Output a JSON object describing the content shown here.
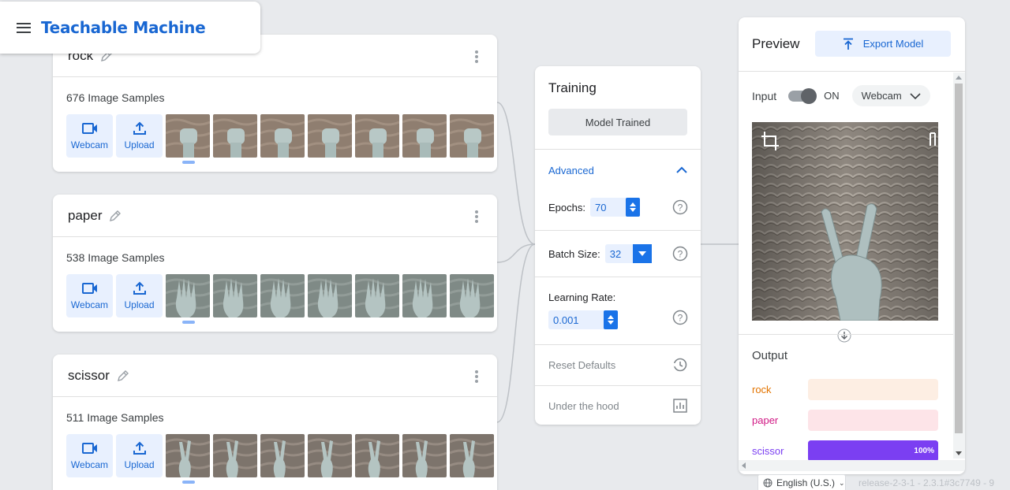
{
  "header": {
    "app_title": "Teachable Machine"
  },
  "classes": [
    {
      "name": "rock",
      "samples": "676 Image Samples",
      "webcam_label": "Webcam",
      "upload_label": "Upload",
      "thumb_count": 7
    },
    {
      "name": "paper",
      "samples": "538 Image Samples",
      "webcam_label": "Webcam",
      "upload_label": "Upload",
      "thumb_count": 7
    },
    {
      "name": "scissor",
      "samples": "511 Image Samples",
      "webcam_label": "Webcam",
      "upload_label": "Upload",
      "thumb_count": 7
    }
  ],
  "training": {
    "title": "Training",
    "status_button": "Model Trained",
    "advanced_label": "Advanced",
    "epochs_label": "Epochs:",
    "epochs_value": "70",
    "batch_label": "Batch Size:",
    "batch_value": "32",
    "lr_label": "Learning Rate:",
    "lr_value": "0.001",
    "reset_label": "Reset Defaults",
    "hood_label": "Under the hood"
  },
  "preview": {
    "title": "Preview",
    "export_label": "Export Model",
    "input_label": "Input",
    "toggle_state": "ON",
    "camera_select": "Webcam",
    "output_title": "Output",
    "outputs": [
      {
        "label": "rock",
        "color": "#e37400",
        "track": "#fdeee3",
        "fill": "#fdeee3",
        "percent": 0,
        "percent_text": ""
      },
      {
        "label": "paper",
        "color": "#d01884",
        "track": "#fde4e8",
        "fill": "#fde4e8",
        "percent": 0,
        "percent_text": ""
      },
      {
        "label": "scissor",
        "color": "#7b3ff2",
        "track": "#7b3ff2",
        "fill": "#7b3ff2",
        "percent": 1.0,
        "percent_text": "100%"
      }
    ]
  },
  "footer": {
    "language": "English (U.S.)",
    "release": "release-2-3-1 - 2.3.1#3c7749 - 9"
  },
  "colors": {
    "accent": "#1967d2",
    "accent_bg": "#e8f0fe",
    "background": "#e8eaed"
  }
}
